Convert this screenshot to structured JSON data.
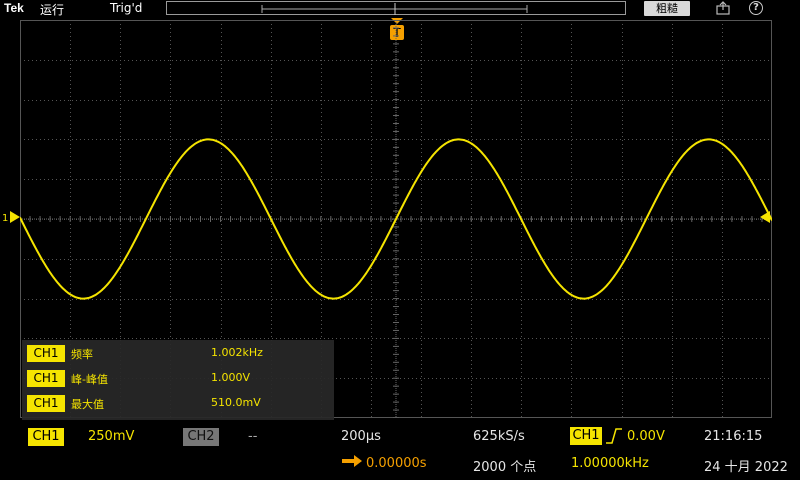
{
  "topbar": {
    "brand": "Tek",
    "run_state": "运行",
    "trigger_state": "Trig'd",
    "coarse_button": "粗糙",
    "export_icon": "export-icon",
    "help_icon": "?"
  },
  "trigger_marker": "T",
  "ground_marker": "1",
  "measurements": [
    {
      "channel": "CH1",
      "name": "频率",
      "value": "1.002kHz"
    },
    {
      "channel": "CH1",
      "name": "峰-峰值",
      "value": "1.000V"
    },
    {
      "channel": "CH1",
      "name": "最大值",
      "value": "510.0mV"
    }
  ],
  "status": {
    "ch1_label": "CH1",
    "ch1_scale": "250mV",
    "ch2_label": "CH2",
    "ch2_scale": "--",
    "timebase": "200µs",
    "sample_rate": "625kS/s",
    "trig_channel": "CH1",
    "trig_level": "0.00V",
    "time": "21:16:15",
    "horiz_pos": "0.00000s",
    "record_length": "2000 个点",
    "trig_freq": "1.00000kHz",
    "date": "24 十月 2022"
  },
  "colors": {
    "ch1": "#f5e400",
    "trigger_marker": "#f5a000",
    "grid": "#555555"
  },
  "waveform": {
    "frequency_khz": 1.002,
    "amplitude_v": 0.5,
    "volts_per_div": 0.25,
    "time_per_div_us": 200
  }
}
